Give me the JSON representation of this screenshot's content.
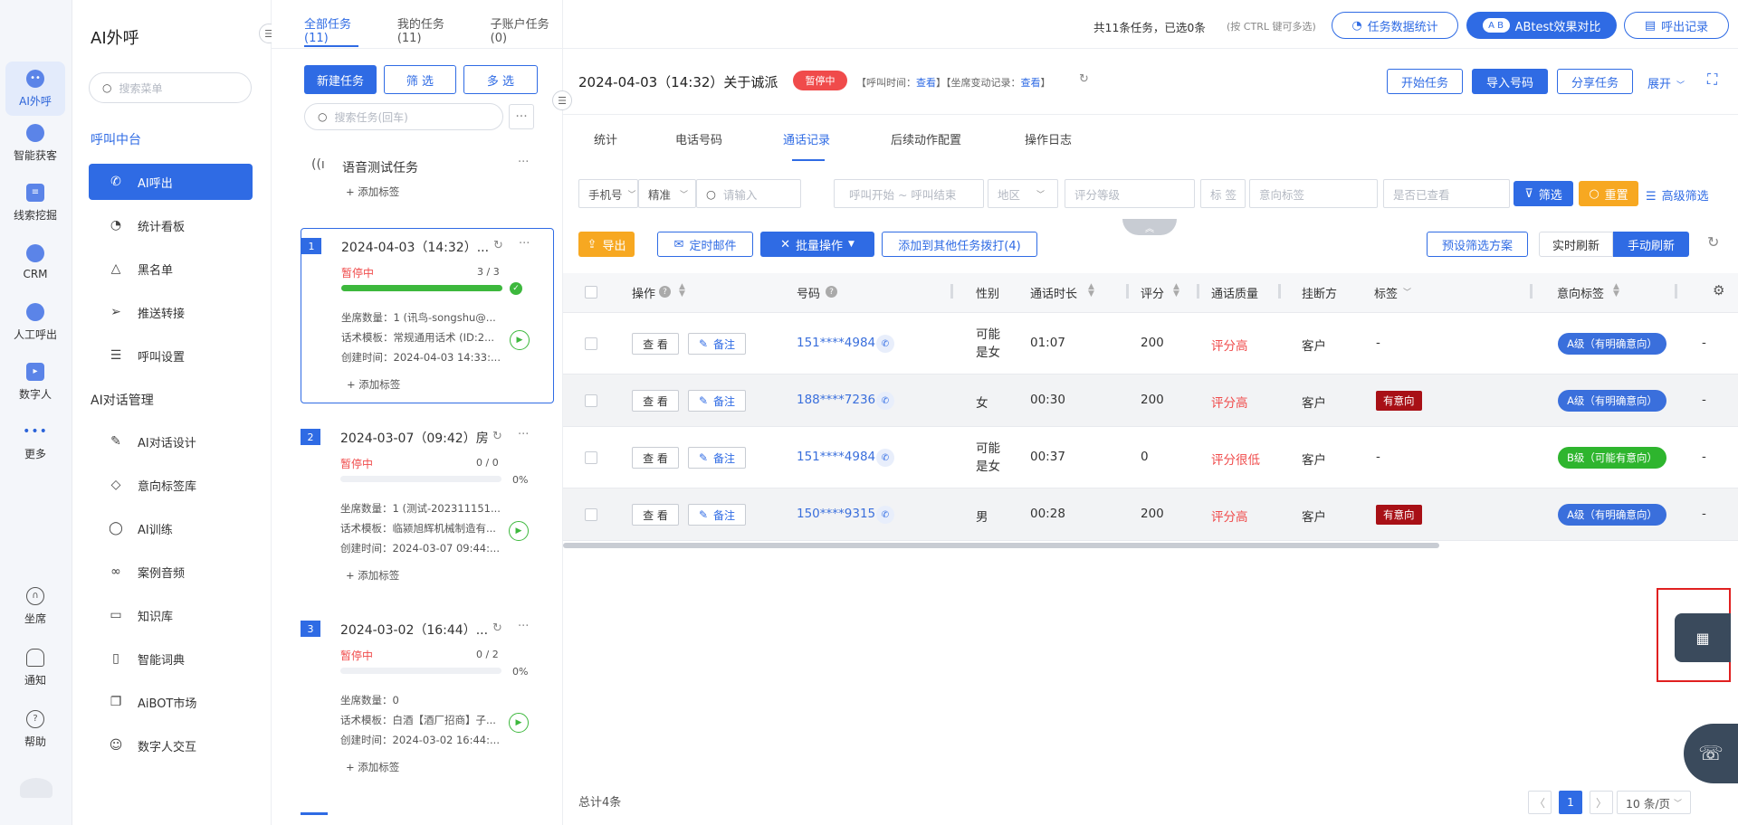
{
  "rail": {
    "items": [
      {
        "label": "AI外呼",
        "icon": "ai-call-icon",
        "active": true
      },
      {
        "label": "智能获客",
        "icon": "customer-icon"
      },
      {
        "label": "线索挖掘",
        "icon": "lead-icon"
      },
      {
        "label": "CRM",
        "icon": "crm-icon"
      },
      {
        "label": "人工呼出",
        "icon": "manual-call-icon"
      },
      {
        "label": "数字人",
        "icon": "digital-human-icon"
      },
      {
        "label": "更多",
        "icon": "more-icon"
      }
    ],
    "bottom": [
      {
        "label": "坐席",
        "icon": "headset-icon"
      },
      {
        "label": "通知",
        "icon": "bell-icon"
      },
      {
        "label": "帮助",
        "icon": "help-icon"
      }
    ]
  },
  "menu": {
    "title": "AI外呼",
    "search_placeholder": "搜索菜单",
    "section1": "呼叫中台",
    "section2": "AI对话管理",
    "items1": [
      {
        "label": "AI呼出",
        "active": true
      },
      {
        "label": "统计看板"
      },
      {
        "label": "黑名单"
      },
      {
        "label": "推送转接"
      },
      {
        "label": "呼叫设置"
      }
    ],
    "items2": [
      {
        "label": "AI对话设计"
      },
      {
        "label": "意向标签库"
      },
      {
        "label": "AI训练"
      },
      {
        "label": "案例音频"
      },
      {
        "label": "知识库"
      },
      {
        "label": "智能词典"
      },
      {
        "label": "AiBOT市场"
      },
      {
        "label": "数字人交互"
      }
    ]
  },
  "tasks": {
    "tabs": [
      "全部任务(11)",
      "我的任务(11)",
      "子账户任务(0)"
    ],
    "new_task": "新建任务",
    "filter": "筛 选",
    "multi": "多 选",
    "search_placeholder": "搜索任务(回车)",
    "voice_test": "语音测试任务",
    "add_tag": "+ 添加标签",
    "cards": [
      {
        "num": "1",
        "title": "2024-04-03（14:32）...",
        "status": "暂停中",
        "count": "3 / 3",
        "progress": 1.0,
        "seats": "坐席数量：1 (讯鸟-songshu@...",
        "template": "话术模板：常规通用话术 (ID:2...",
        "created": "创建时间：2024-04-03 14:33:..."
      },
      {
        "num": "2",
        "title": "2024-03-07（09:42）房",
        "status": "暂停中",
        "count": "0 / 0",
        "percent": "0%",
        "progress": 0,
        "seats": "坐席数量：1 (测试-202311151...",
        "template": "话术模板：临颍旭辉机械制造有...",
        "created": "创建时间：2024-03-07 09:44:..."
      },
      {
        "num": "3",
        "title": "2024-03-02（16:44）...",
        "status": "暂停中",
        "count": "0 / 2",
        "percent": "0%",
        "progress": 0,
        "seats": "坐席数量：0",
        "template": "话术模板：白酒【酒厂招商】子...",
        "created": "创建时间：2024-03-02 16:44:..."
      }
    ]
  },
  "top": {
    "summary": "共11条任务，已选0条",
    "hint": "(按 CTRL 键可多选)",
    "stats_btn": "任务数据统计",
    "ab_btn": "ABtest效果对比",
    "records_btn": "呼出记录"
  },
  "detail": {
    "title": "2024-04-03（14:32）关于诚派",
    "status": "暂停中",
    "call_time_label": "【呼叫时间：",
    "view": "查看",
    "seat_change_label": "】【坐席变动记录：",
    "close_bracket": "】",
    "start": "开始任务",
    "import": "导入号码",
    "share": "分享任务",
    "expand": "展开"
  },
  "subtabs": [
    "统计",
    "电话号码",
    "通话记录",
    "后续动作配置",
    "操作日志"
  ],
  "filters": {
    "phone_type": "手机号",
    "match": "精准",
    "input_placeholder": "请输入",
    "time_placeholder": "呼叫开始 ~ 呼叫结束",
    "region": "地区",
    "score": "评分等级",
    "tag": "标 签",
    "intent": "意向标签",
    "viewed": "是否已查看",
    "filter_btn": "筛选",
    "reset_btn": "重置",
    "advanced": "高级筛选"
  },
  "actions": {
    "export": "导出",
    "timed_mail": "定时邮件",
    "batch": "批量操作",
    "add_other": "添加到其他任务拨打(4)",
    "preset": "预设筛选方案",
    "realtime": "实时刷新",
    "manual": "手动刷新"
  },
  "table": {
    "headers": [
      "操作",
      "号码",
      "性别",
      "通话时长",
      "评分",
      "通话质量",
      "挂断方",
      "标签",
      "意向标签"
    ],
    "view_btn": "查 看",
    "note_btn": "备注",
    "rows": [
      {
        "phone": "151****4984",
        "gender": "可能是女",
        "duration": "01:07",
        "score": "200",
        "quality": "评分高",
        "hangup": "客户",
        "tag": "-",
        "intent": "A级（有明确意向）",
        "intent_color": "blue",
        "last": "-"
      },
      {
        "phone": "188****7236",
        "gender": "女",
        "duration": "00:30",
        "score": "200",
        "quality": "评分高",
        "hangup": "客户",
        "tag": "有意向",
        "intent": "A级（有明确意向）",
        "intent_color": "blue",
        "last": "-"
      },
      {
        "phone": "151****4984",
        "gender": "可能是女",
        "duration": "00:37",
        "score": "0",
        "quality": "评分很低",
        "hangup": "客户",
        "tag": "-",
        "intent": "B级（可能有意向）",
        "intent_color": "green",
        "last": "-"
      },
      {
        "phone": "150****9315",
        "gender": "男",
        "duration": "00:28",
        "score": "200",
        "quality": "评分高",
        "hangup": "客户",
        "tag": "有意向",
        "intent": "A级（有明确意向）",
        "intent_color": "blue",
        "last": "-"
      }
    ]
  },
  "footer": {
    "total": "总计4条",
    "page": "1",
    "page_size": "10 条/页"
  }
}
